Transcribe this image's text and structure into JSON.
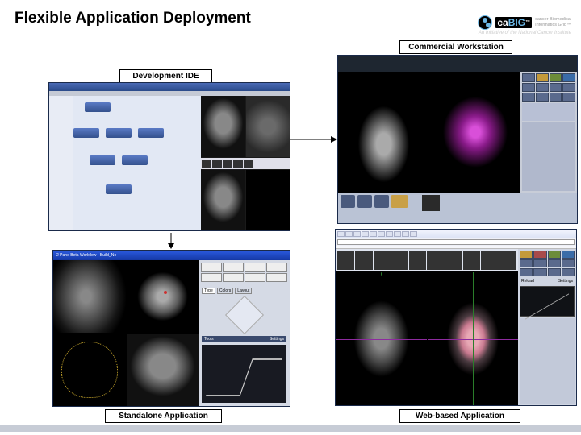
{
  "header": {
    "title": "Flexible Application Deployment",
    "logo_text": "ca",
    "logo_big": "BIG",
    "logo_sub1": "cancer Biomedical",
    "logo_sub2": "Informatics Grid™",
    "tagline": "An Initiative of the National Cancer Institute"
  },
  "labels": {
    "commercial": "Commercial Workstation",
    "development": "Development IDE",
    "standalone": "Standalone Application",
    "web": "Web-based Application"
  },
  "standalone": {
    "title": "2 Pane Beta Workflow - Build_No",
    "tabs": {
      "type": "Type",
      "colors": "Colors",
      "layout": "Layout"
    },
    "tools": "Tools",
    "settings": "Settings"
  },
  "web": {
    "reload": "Reload",
    "settings": "Settings"
  }
}
